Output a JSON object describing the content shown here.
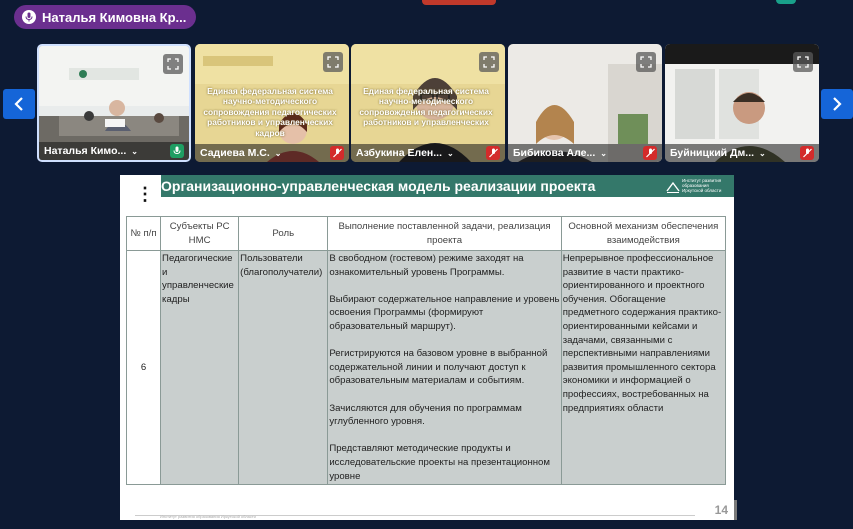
{
  "speaker": {
    "name": "Наталья Кимовна Кр...",
    "icon": "microphone-icon"
  },
  "colors": {
    "background": "#0d1a33",
    "speaker_pill": "#6b2f8f",
    "nav_arrow": "#1565d8",
    "slide_header": "#34786a",
    "table_grey": "#c9cfce",
    "mic_on": "#1f9e63",
    "mic_off": "#d32b2b"
  },
  "tiles": [
    {
      "name": "Наталья Кимо...",
      "mic": "on",
      "active": true,
      "banner": ""
    },
    {
      "name": "Садиева М.С.",
      "mic": "off",
      "active": false,
      "banner": "Единая федеральная система научно-методического сопровождения педагогических работников и управленческих кадров"
    },
    {
      "name": "Азбукина Елен...",
      "mic": "off",
      "active": false,
      "banner": "Единая федеральная система научно-методического сопровождения педагогических работников и управленческих кадров"
    },
    {
      "name": "Бибикова Але...",
      "mic": "off",
      "active": false,
      "banner": ""
    },
    {
      "name": "Буйницкий Дм...",
      "mic": "off",
      "active": false,
      "banner": ""
    }
  ],
  "slide": {
    "title": "Организационно-управленческая модель реализации проекта",
    "logo_text": "Институт развития образования Иркутской области",
    "page_number": "14",
    "footer": "Институт развития образования Иркутской области",
    "headers": [
      "№ п/п",
      "Субъекты РС НМС",
      "Роль",
      "Выполнение поставленной задачи, реализация проекта",
      "Основной механизм обеспечения взаимодействия"
    ],
    "row": {
      "number": "6",
      "subjects": "Педагогические и управленческие кадры",
      "role": "Пользователи (благополучатели)",
      "tasks": [
        "В свободном (гостевом) режиме заходят на ознакомительный уровень Программы.",
        "Выбирают содержательное направление и уровень освоения Программы (формируют образовательный маршрут).",
        "Регистрируются на базовом уровне в выбранной содержательной линии и получают доступ к образовательным материалам и событиям.",
        "Зачисляются для обучения по программам углубленного уровня.",
        "Представляют методические продукты и исследовательские проекты на презентационном уровне"
      ],
      "mechanism": "Непрерывное профессиональное развитие в части практико-ориентированного и проектного обучения. Обогащение предметного содержания практико-ориентированными кейсами и задачами, связанными с перспективными направлениями развития промышленного сектора экономики и информацией о профессиях, востребованных на предприятиях области"
    }
  }
}
